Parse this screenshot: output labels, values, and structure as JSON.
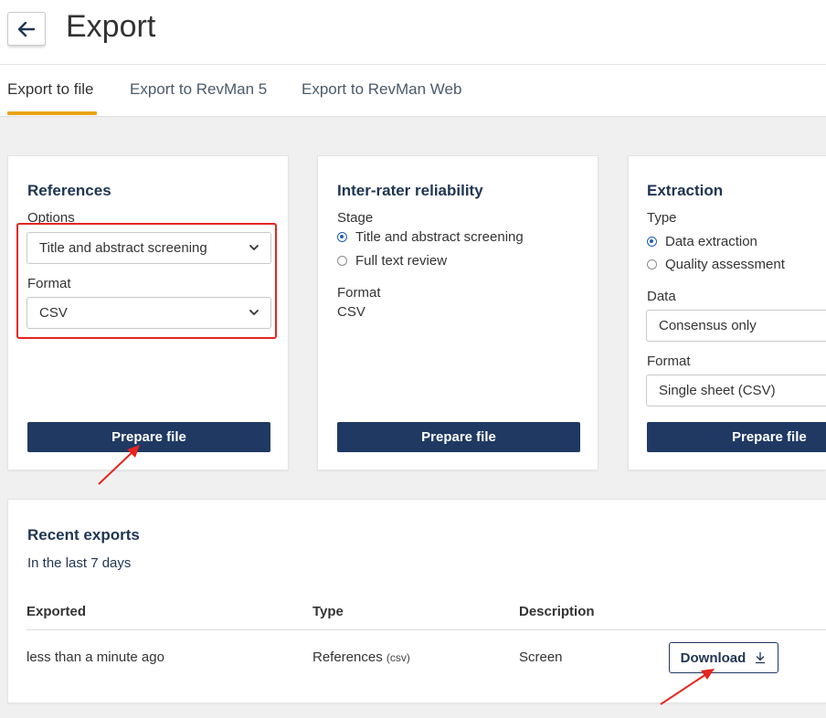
{
  "header": {
    "title": "Export",
    "back_icon": "arrow-left-icon"
  },
  "tabs": [
    {
      "label": "Export to file",
      "active": true
    },
    {
      "label": "Export to RevMan 5",
      "active": false
    },
    {
      "label": "Export to RevMan Web",
      "active": false
    }
  ],
  "references": {
    "title": "References",
    "options_label": "Options",
    "options_value": "Title and abstract screening",
    "format_label": "Format",
    "format_value": "CSV",
    "button": "Prepare file"
  },
  "irr": {
    "title": "Inter-rater reliability",
    "stage_label": "Stage",
    "stage_options": [
      {
        "label": "Title and abstract screening",
        "checked": true
      },
      {
        "label": "Full text review",
        "checked": false
      }
    ],
    "format_label": "Format",
    "format_value": "CSV",
    "button": "Prepare file"
  },
  "extraction": {
    "title": "Extraction",
    "type_label": "Type",
    "type_options": [
      {
        "label": "Data extraction",
        "checked": true
      },
      {
        "label": "Quality assessment",
        "checked": false
      }
    ],
    "data_label": "Data",
    "data_value": "Consensus only",
    "format_label": "Format",
    "format_value": "Single sheet (CSV)",
    "button": "Prepare file"
  },
  "recent": {
    "title": "Recent exports",
    "subtitle": "In the last 7 days",
    "columns": [
      "Exported",
      "Type",
      "Description"
    ],
    "rows": [
      {
        "exported": "less than a minute ago",
        "type": "References",
        "type_suffix": "(csv)",
        "description": "Screen",
        "action": "Download",
        "action_icon": "download-icon"
      }
    ]
  },
  "colors": {
    "accent": "#e8a317",
    "primary": "#1f3963",
    "annotation": "#e3261e"
  }
}
